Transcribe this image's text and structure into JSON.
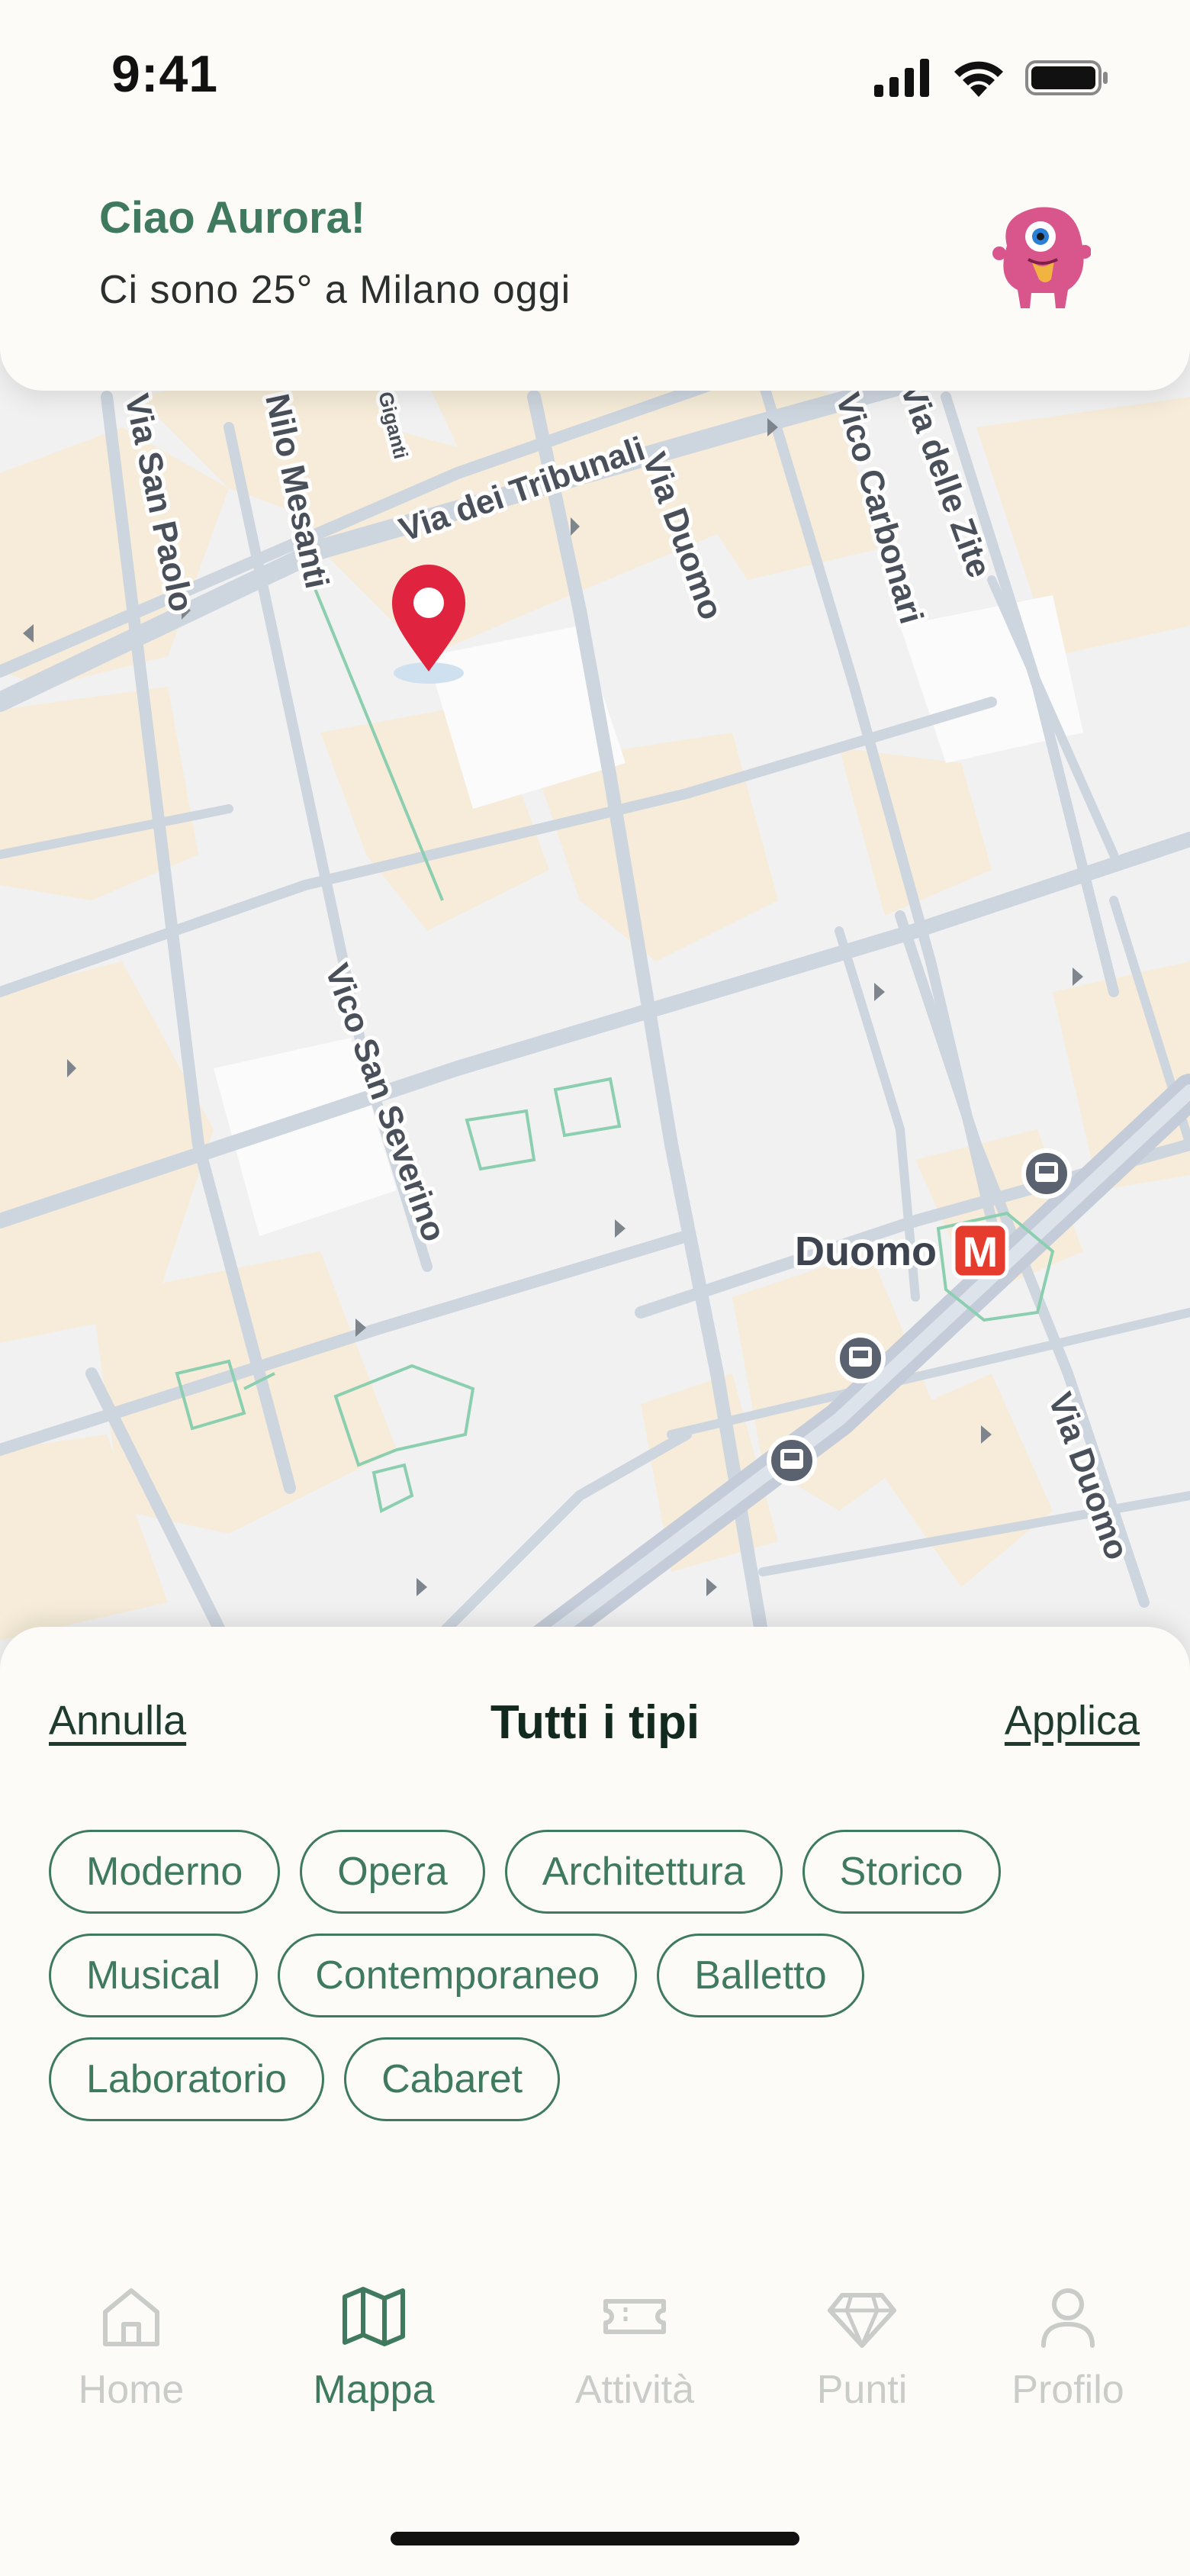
{
  "status_bar": {
    "time": "9:41"
  },
  "header": {
    "greeting": "Ciao Aurora!",
    "subtitle": "Ci sono 25° a Milano oggi"
  },
  "map": {
    "street_labels": [
      "Via dei Tribunali",
      "Via Duomo",
      "Vico Carbonari",
      "Via delle Zite",
      "Via San Paolo",
      "Vico San Severino",
      "Via Duomo",
      "Giganti",
      "Nilo Mesanti"
    ],
    "poi": {
      "name": "Duomo",
      "metro_badge": "M"
    },
    "icons": [
      "location-pin-icon",
      "bus-stop-icon",
      "metro-icon"
    ]
  },
  "filter_sheet": {
    "cancel_label": "Annulla",
    "title": "Tutti i tipi",
    "apply_label": "Applica",
    "chips": [
      "Moderno",
      "Opera",
      "Architettura",
      "Storico",
      "Musical",
      "Contemporaneo",
      "Balletto",
      "Laboratorio",
      "Cabaret"
    ]
  },
  "tabbar": {
    "items": [
      {
        "label": "Home",
        "icon": "home-icon",
        "active": false
      },
      {
        "label": "Mappa",
        "icon": "map-icon",
        "active": true
      },
      {
        "label": "Attività",
        "icon": "ticket-icon",
        "active": false
      },
      {
        "label": "Punti",
        "icon": "diamond-icon",
        "active": false
      },
      {
        "label": "Profilo",
        "icon": "user-icon",
        "active": false
      }
    ]
  },
  "colors": {
    "brand_green": "#3f7a5e",
    "pin_red": "#e0243f",
    "metro_red": "#e53c2e",
    "background": "#fcfbf8"
  }
}
